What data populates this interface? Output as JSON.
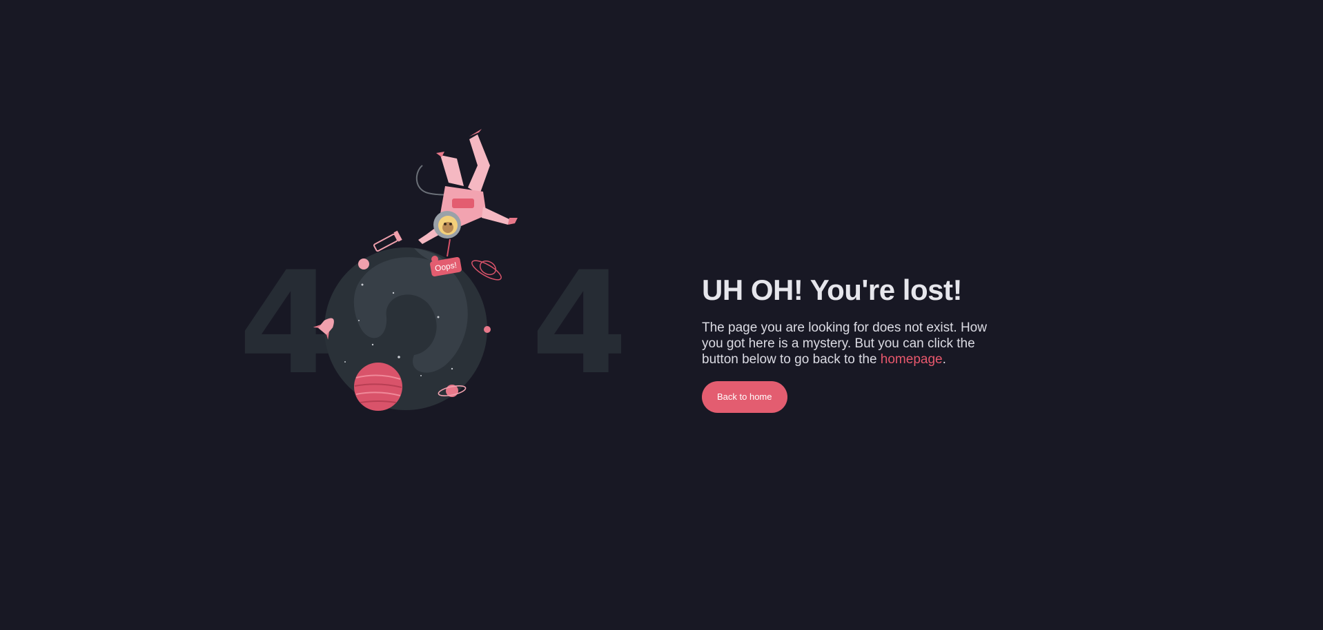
{
  "illustration": {
    "digit_left": "4",
    "digit_right": "4",
    "sign_text": "Oops!"
  },
  "content": {
    "title": "UH OH! You're lost!",
    "description_before": "The page you are looking for does not exist. How you got here is a mystery. But you can click the button below to go back to the ",
    "link_label": "homepage",
    "description_after": ".",
    "button_label": "Back to home"
  },
  "colors": {
    "background": "#181824",
    "accent": "#e35d70",
    "digit": "#262c34",
    "planet": "#2a3138"
  }
}
